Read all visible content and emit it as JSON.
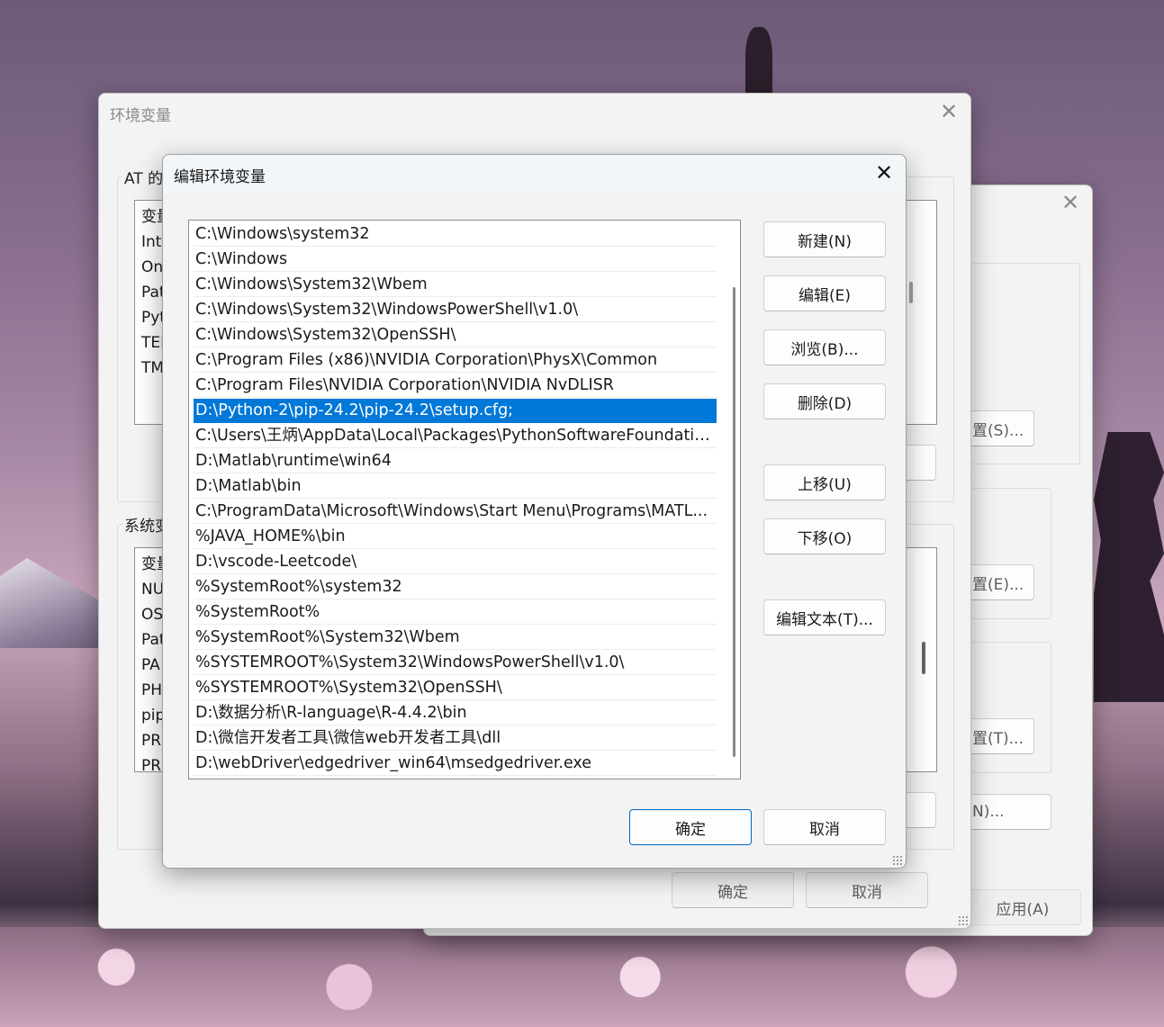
{
  "env_window": {
    "title": "环境变量",
    "user_group_label": "AT 的",
    "user_vars": [
      "变量",
      "Int",
      "On",
      "Pat",
      "Pyt",
      "TEI",
      "TM"
    ],
    "system_group_label": "系统变",
    "system_vars": [
      "变量",
      "NU",
      "OS",
      "Pat",
      "PA",
      "PH",
      "pip",
      "PR",
      "PR"
    ],
    "ok_label": "确定",
    "cancel_label": "取消"
  },
  "props_window": {
    "btn_settings_s": "置(S)...",
    "btn_settings_e": "置(E)...",
    "btn_settings_t": "置(T)...",
    "btn_n": "N)...",
    "apply_label": "应用(A)"
  },
  "edit_dialog": {
    "title": "编辑环境变量",
    "paths": [
      "C:\\Windows\\system32",
      "C:\\Windows",
      "C:\\Windows\\System32\\Wbem",
      "C:\\Windows\\System32\\WindowsPowerShell\\v1.0\\",
      "C:\\Windows\\System32\\OpenSSH\\",
      "C:\\Program Files (x86)\\NVIDIA Corporation\\PhysX\\Common",
      "C:\\Program Files\\NVIDIA Corporation\\NVIDIA NvDLISR",
      "D:\\Python-2\\pip-24.2\\pip-24.2\\setup.cfg;",
      "C:\\Users\\王炳\\AppData\\Local\\Packages\\PythonSoftwareFoundatio...",
      "D:\\Matlab\\runtime\\win64",
      "D:\\Matlab\\bin",
      "C:\\ProgramData\\Microsoft\\Windows\\Start Menu\\Programs\\MATL...",
      "%JAVA_HOME%\\bin",
      "D:\\vscode-Leetcode\\",
      "%SystemRoot%\\system32",
      "%SystemRoot%",
      "%SystemRoot%\\System32\\Wbem",
      "%SYSTEMROOT%\\System32\\WindowsPowerShell\\v1.0\\",
      "%SYSTEMROOT%\\System32\\OpenSSH\\",
      "D:\\数据分析\\R-language\\R-4.4.2\\bin",
      "D:\\微信开发者工具\\微信web开发者工具\\dll",
      "D:\\webDriver\\edgedriver_win64\\msedgedriver.exe"
    ],
    "selected_index": 7,
    "buttons": {
      "new": "新建(N)",
      "edit": "编辑(E)",
      "browse": "浏览(B)...",
      "delete": "删除(D)",
      "move_up": "上移(U)",
      "move_down": "下移(O)",
      "edit_text": "编辑文本(T)..."
    },
    "ok_label": "确定",
    "cancel_label": "取消"
  },
  "icons": {
    "close": "close-icon"
  },
  "colors": {
    "selection": "#0078d7",
    "primary_border": "#0067c0"
  }
}
